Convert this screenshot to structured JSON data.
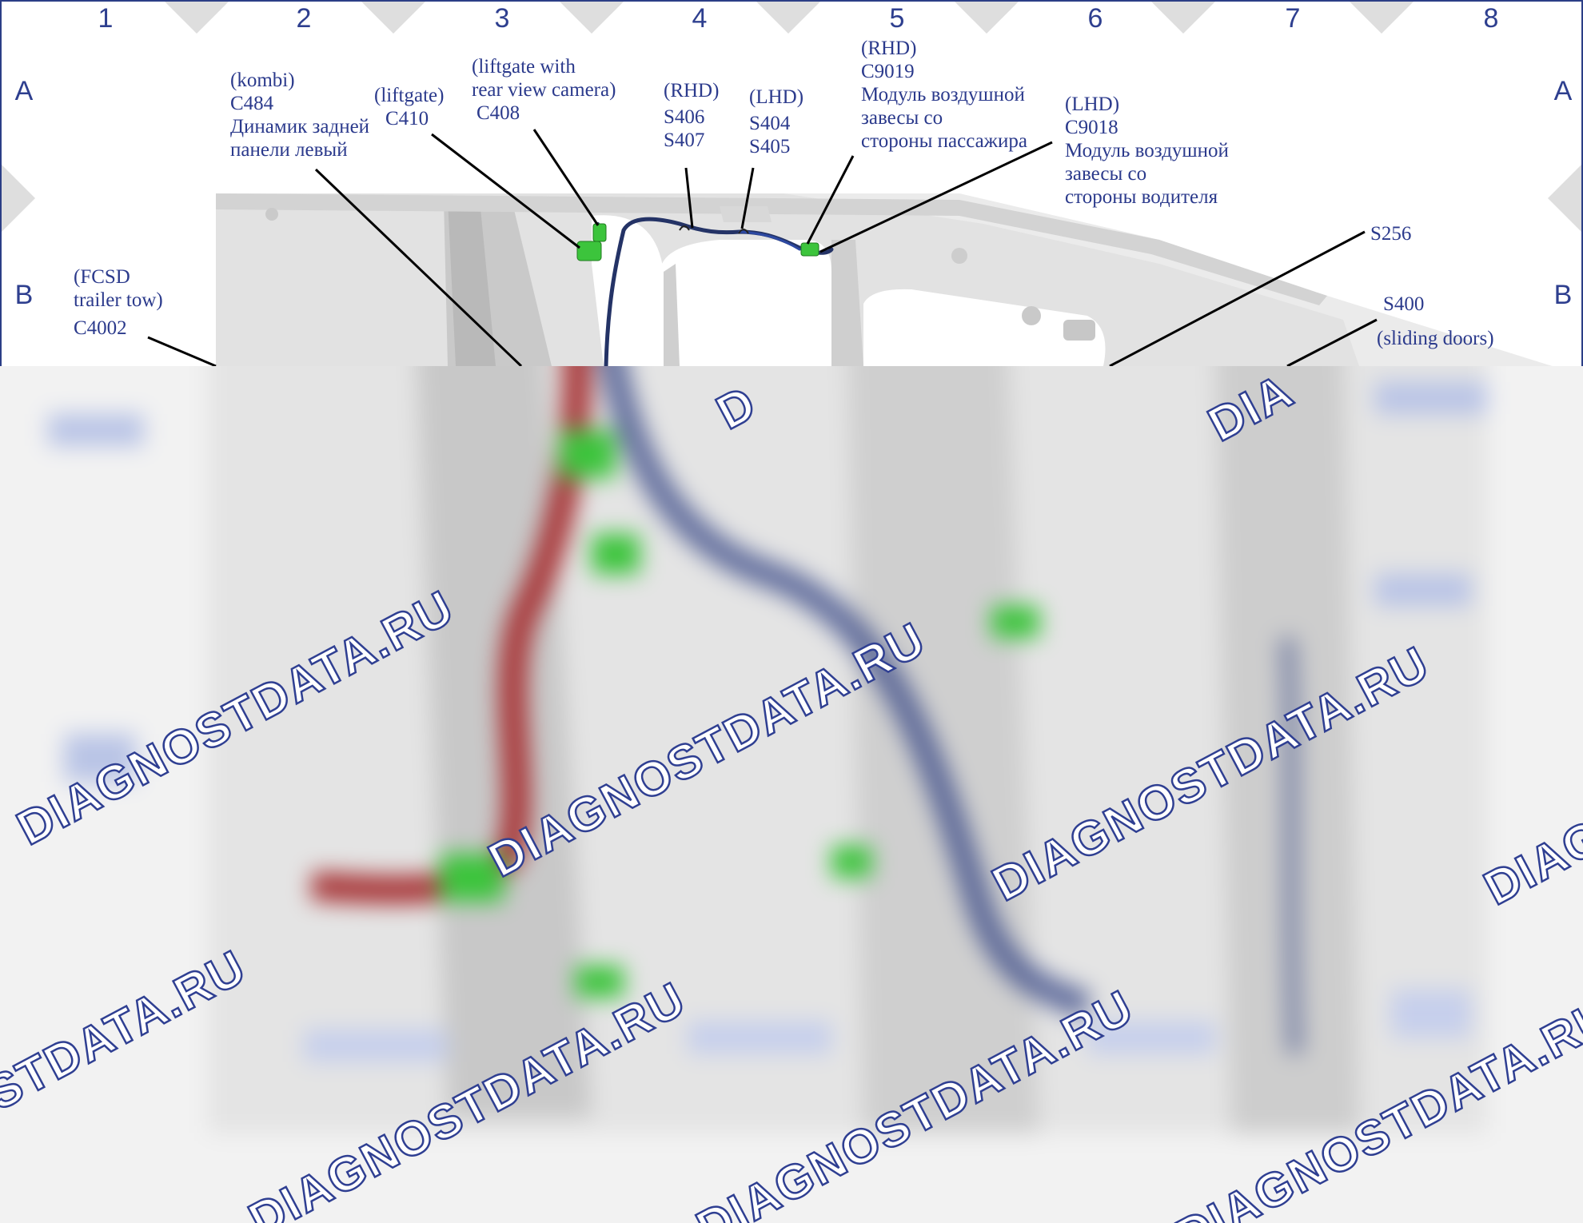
{
  "grid": {
    "columns": [
      "1",
      "2",
      "3",
      "4",
      "5",
      "6",
      "7",
      "8"
    ],
    "rows_left": [
      "A",
      "B"
    ],
    "rows_right": [
      "A",
      "B"
    ]
  },
  "callouts": {
    "c4002": [
      "(FCSD",
      "trailer tow)",
      "C4002"
    ],
    "c484": [
      "(kombi)",
      "C484",
      "Динамик задней",
      "панели левый"
    ],
    "c410": [
      "(liftgate)",
      "C410"
    ],
    "c408": [
      "(liftgate with",
      "rear view camera)",
      "C408"
    ],
    "s406": [
      "(RHD)",
      "S406",
      "S407"
    ],
    "s404": [
      "(LHD)",
      "S404",
      "S405"
    ],
    "c9019": [
      "(RHD)",
      "C9019",
      "Модуль воздушной",
      "завесы со",
      "стороны пассажира"
    ],
    "c9018": [
      "(LHD)",
      "C9018",
      "Модуль воздушной",
      "завесы со",
      "стороны водителя"
    ],
    "s256": [
      "S256"
    ],
    "s400": [
      "S400",
      "",
      "(sliding doors)"
    ]
  },
  "watermark": {
    "text": "DIAGNOSTDATA.RU",
    "partial_left": "DIA",
    "partial_mid": "D"
  },
  "colors": {
    "label": "#2b3a8c",
    "wire_blue": "#2c3d80",
    "wire_red": "#a8383a",
    "connector_green": "#3cc43c",
    "body_grey": "#dcdcdc"
  }
}
